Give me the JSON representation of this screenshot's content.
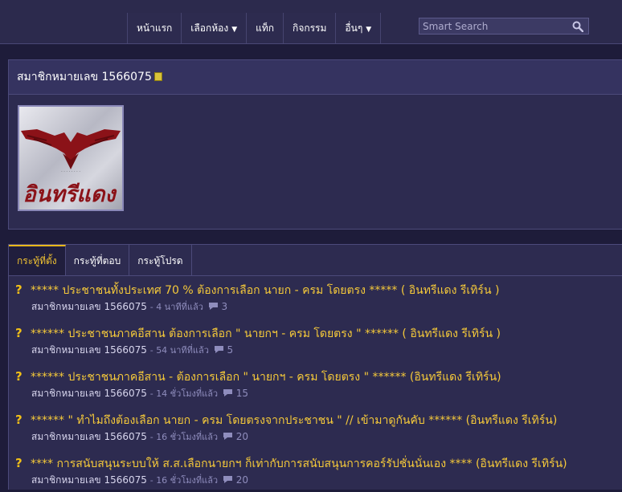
{
  "nav": {
    "items": [
      {
        "label": "หน้าแรก",
        "caret": ""
      },
      {
        "label": "เลือกห้อง",
        "caret": "▼"
      },
      {
        "label": "แท็ก",
        "caret": ""
      },
      {
        "label": "กิจกรรม",
        "caret": ""
      },
      {
        "label": "อื่นๆ",
        "caret": "▼"
      }
    ]
  },
  "search": {
    "placeholder": "Smart Search",
    "icon": "search-icon"
  },
  "profile": {
    "title": "สมาชิกหมายเลข 1566075",
    "avatar_text": "อินทรีแดง"
  },
  "tabs": [
    {
      "label": "กระทู้ที่ตั้ง",
      "active": true
    },
    {
      "label": "กระทู้ที่ตอบ",
      "active": false
    },
    {
      "label": "กระทู้โปรด",
      "active": false
    }
  ],
  "posts": [
    {
      "title": "***** ประชาชนทั้งประเทศ 70 % ต้องการเลือก นายก - ครม โดยตรง ***** ( อินทรีแดง รีเทิร์น )",
      "author": "สมาชิกหมายเลข 1566075",
      "time": "4 นาทีที่แล้ว",
      "comments": "3"
    },
    {
      "title": "****** ประชาชนภาคอีสาน ต้องการเลือก \" นายกฯ - ครม โดยตรง \" ****** ( อินทรีแดง รีเทิร์น )",
      "author": "สมาชิกหมายเลข 1566075",
      "time": "54 นาทีที่แล้ว",
      "comments": "5"
    },
    {
      "title": "****** ประชาชนภาคอีสาน - ต้องการเลือก \" นายกฯ - ครม โดยตรง \" ****** (อินทรีแดง รีเทิร์น)",
      "author": "สมาชิกหมายเลข 1566075",
      "time": "14 ชั่วโมงที่แล้ว",
      "comments": "15"
    },
    {
      "title": "****** \" ทำไมถึงต้องเลือก นายก - ครม โดยตรงจากประชาชน \" // เข้ามาดูกันคับ ****** (อินทรีแดง รีเทิร์น)",
      "author": "สมาชิกหมายเลข 1566075",
      "time": "16 ชั่วโมงที่แล้ว",
      "comments": "20"
    },
    {
      "title": "**** การสนับสนุนระบบให้ ส.ส.เลือกนายกฯ ก็เท่ากับการสนับสนุนการคอร์รัปชั่นนั่นเอง **** (อินทรีแดง รีเทิร์น)",
      "author": "สมาชิกหมายเลข 1566075",
      "time": "16 ชั่วโมงที่แล้ว",
      "comments": "20"
    }
  ],
  "colors": {
    "accent": "#f2c017",
    "background": "#1e1c3a",
    "panel": "#2d2b50"
  }
}
